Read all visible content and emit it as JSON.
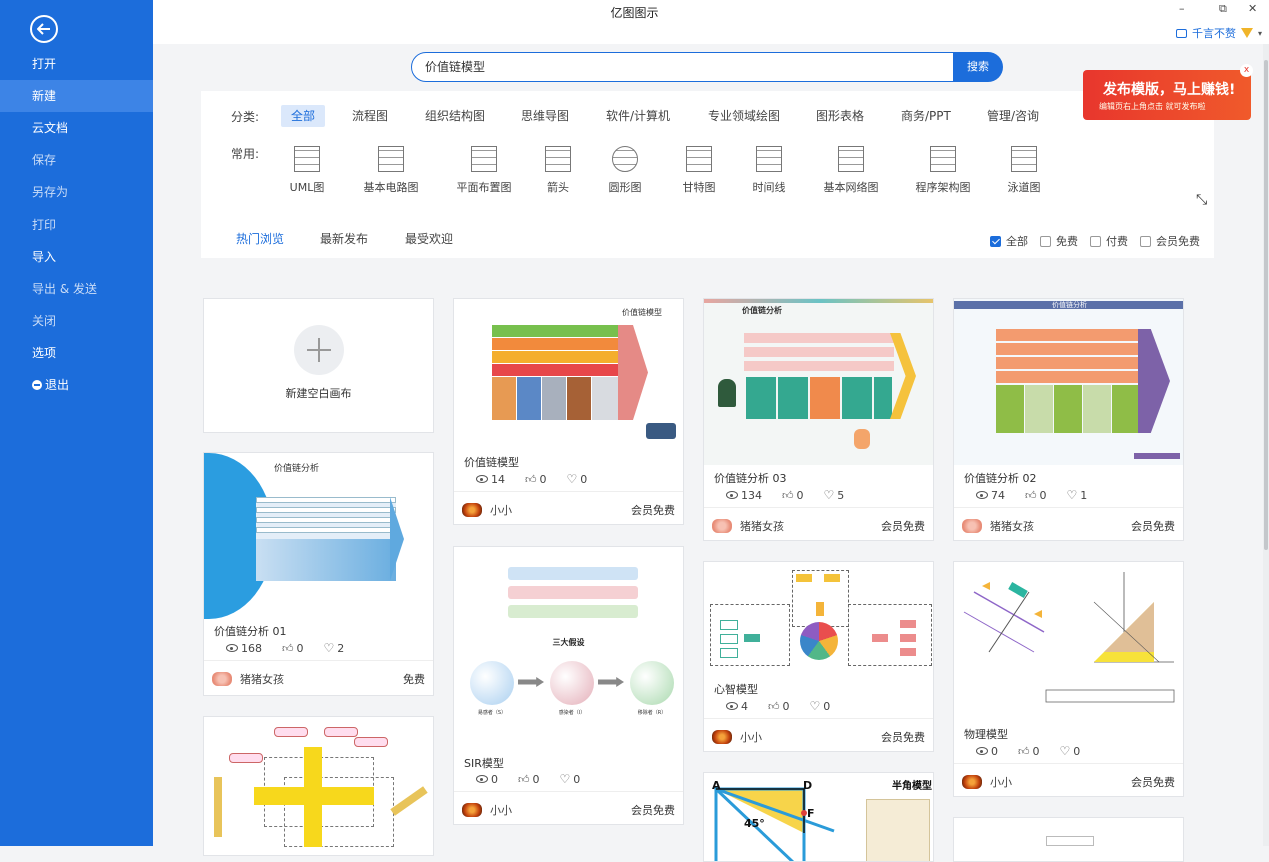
{
  "app": {
    "title": "亿图图示"
  },
  "window": {
    "minimize": "–",
    "restore": "⧉",
    "close": "✕"
  },
  "user": {
    "name": "千言不赘"
  },
  "sidebar": {
    "items": [
      {
        "label": "打开"
      },
      {
        "label": "新建"
      },
      {
        "label": "云文档"
      },
      {
        "label": "保存"
      },
      {
        "label": "另存为"
      },
      {
        "label": "打印"
      },
      {
        "label": "导入"
      },
      {
        "label": "导出 & 发送"
      },
      {
        "label": "关闭"
      },
      {
        "label": "选项"
      },
      {
        "label": "退出"
      }
    ]
  },
  "search": {
    "value": "价值链模型",
    "button": "搜索"
  },
  "categories": {
    "label": "分类:",
    "items": [
      "全部",
      "流程图",
      "组织结构图",
      "思维导图",
      "软件/计算机",
      "专业领域绘图",
      "图形表格",
      "商务/PPT",
      "管理/咨询"
    ]
  },
  "common": {
    "label": "常用:",
    "items": [
      "UML图",
      "基本电路图",
      "平面布置图",
      "箭头",
      "圆形图",
      "甘特图",
      "时间线",
      "基本网络图",
      "程序架构图",
      "泳道图"
    ]
  },
  "tabs": [
    "热门浏览",
    "最新发布",
    "最受欢迎"
  ],
  "filters": [
    "全部",
    "免费",
    "付费",
    "会员免费"
  ],
  "promo": {
    "main": "发布模版，马上赚钱!",
    "sub": "编辑页右上角点击  就可发布啦",
    "close": "x"
  },
  "cards": {
    "blank": {
      "label": "新建空白画布"
    },
    "c1": {
      "title": "价值链模型",
      "views": "14",
      "likes": "0",
      "favs": "0",
      "author": "小小",
      "price": "会员免费",
      "thumb_title": "价值链模型"
    },
    "c2": {
      "title": "价值链分析 03",
      "views": "134",
      "likes": "0",
      "favs": "5",
      "author": "猪猪女孩",
      "price": "会员免费",
      "thumb_title": "价值链分析"
    },
    "c3": {
      "title": "价值链分析 02",
      "views": "74",
      "likes": "0",
      "favs": "1",
      "author": "猪猪女孩",
      "price": "会员免费",
      "thumb_title": "价值链分析"
    },
    "c4": {
      "title": "价值链分析 01",
      "views": "168",
      "likes": "0",
      "favs": "2",
      "author": "猪猪女孩",
      "price": "免费",
      "thumb_title": "价值链分析"
    },
    "c5": {
      "title": "SIR模型",
      "views": "0",
      "likes": "0",
      "favs": "0",
      "author": "小小",
      "price": "会员免费",
      "thumb_title": "三大假设",
      "nodes": [
        "易感者（S）",
        "感染者（I）",
        "移除者（R）"
      ]
    },
    "c6": {
      "title": "心智模型",
      "views": "4",
      "likes": "0",
      "favs": "0",
      "author": "小小",
      "price": "会员免费"
    },
    "c7": {
      "title": "物理模型",
      "views": "0",
      "likes": "0",
      "favs": "0",
      "author": "小小",
      "price": "会员免费"
    },
    "c8": {
      "thumb_title": "半角模型",
      "labels": [
        "A",
        "D",
        "F",
        "45°"
      ]
    },
    "c10": {
      "thumb_title": ""
    }
  }
}
